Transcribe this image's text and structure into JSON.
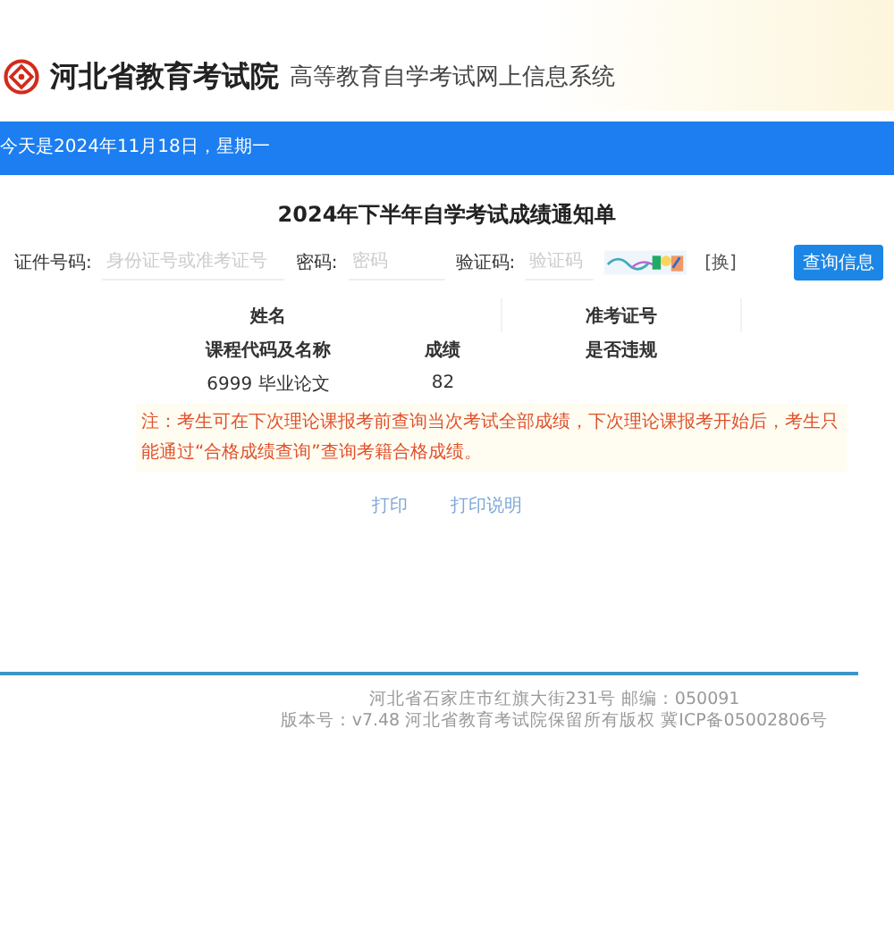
{
  "header": {
    "org": "河北省教育考试院",
    "system": "高等教育自学考试网上信息系统"
  },
  "date_bar": {
    "text": "今天是2024年11月18日，星期一"
  },
  "page_title": "2024年下半年自学考试成绩通知单",
  "form": {
    "id_label": "证件号码:",
    "id_placeholder": "身份证号或准考证号",
    "password_label": "密码:",
    "password_placeholder": "密码",
    "captcha_label": "验证码:",
    "captcha_placeholder": "验证码",
    "refresh": "[换]",
    "submit": "查询信息"
  },
  "table": {
    "name_label": "姓名",
    "ticket_label": "准考证号",
    "columns": [
      "课程代码及名称",
      "成绩",
      "是否违规"
    ],
    "rows": [
      {
        "course": "6999 毕业论文",
        "score": "82"
      }
    ]
  },
  "notice": "注：考生可在下次理论课报考前查询当次考试全部成绩，下次理论课报考开始后，考生只能通过“合格成绩查询”查询考籍合格成绩。",
  "actions": [
    "打印",
    "打印说明"
  ],
  "footer": [
    "河北省石家庄市红旗大街231号   邮编：050091",
    "版本号：v7.48 河北省教育考试院保留所有版权 冀ICP备05002806号"
  ]
}
